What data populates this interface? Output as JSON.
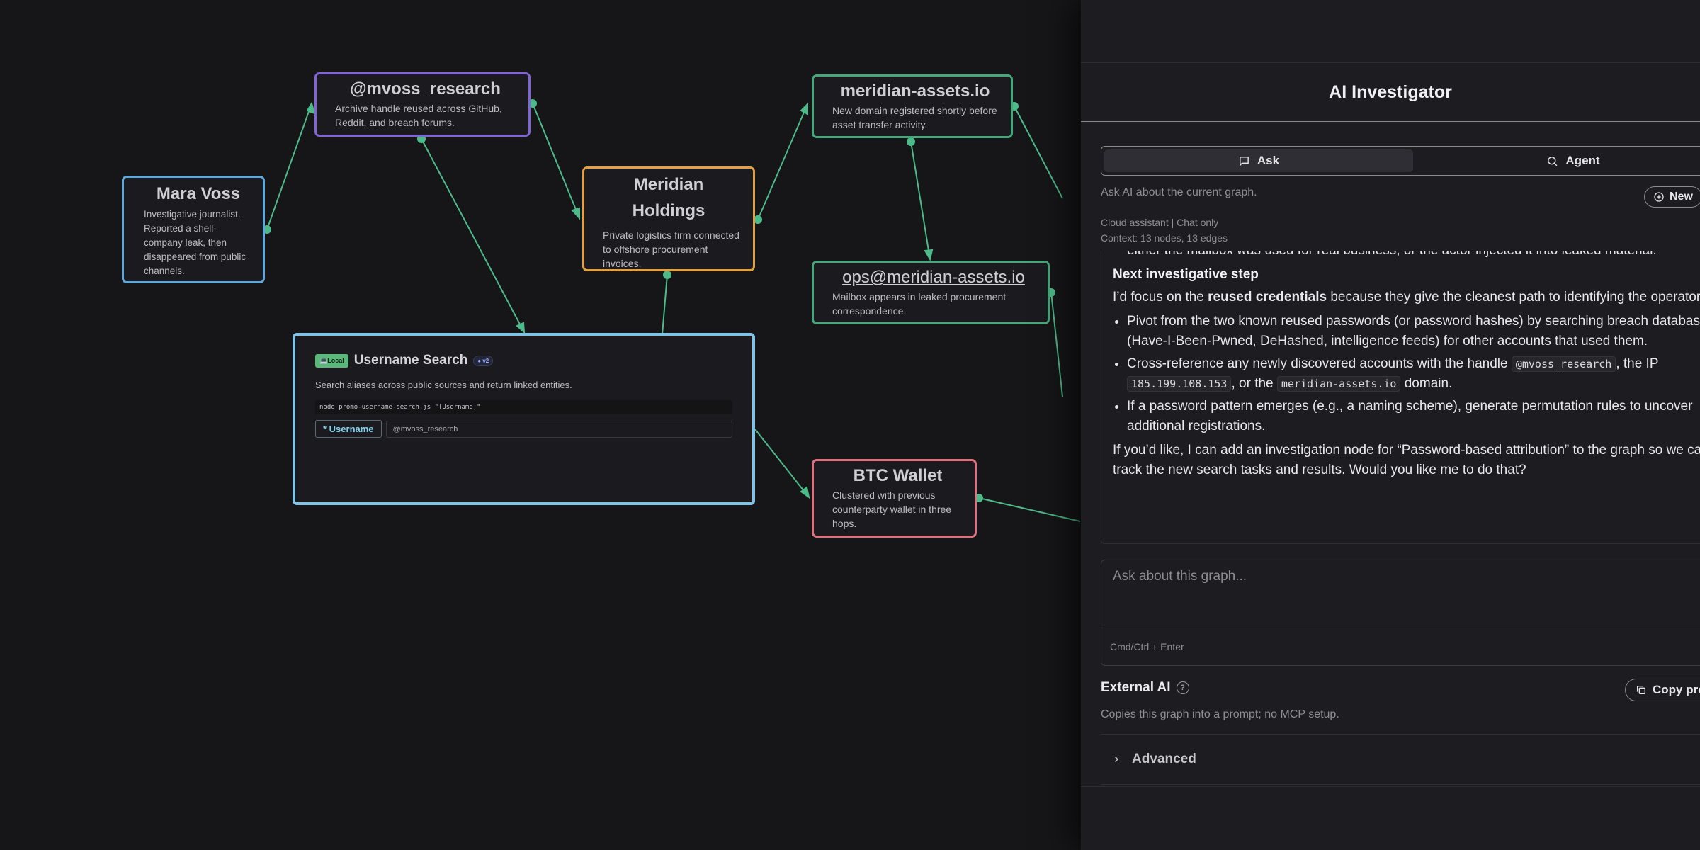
{
  "graph": {
    "nodes": {
      "mara": {
        "title": "Mara Voss",
        "desc": "Investigative journalist. Reported a shell-company leak, then disappeared from public channels."
      },
      "mvoss": {
        "title": "@mvoss_research",
        "desc": "Archive handle reused across GitHub, Reddit, and breach forums."
      },
      "meridian": {
        "title": "Meridian Holdings",
        "desc": "Private logistics firm connected to offshore procurement invoices."
      },
      "domain": {
        "title": "meridian-assets.io",
        "desc": "New domain registered shortly before asset transfer activity."
      },
      "ops": {
        "title": "ops@meridian-assets.io",
        "desc": "Mailbox appears in leaked procurement correspondence."
      },
      "btc": {
        "title": "BTC Wallet",
        "desc": "Clustered with previous counterparty wallet in three hops."
      }
    },
    "tool": {
      "badge_local": "Local",
      "title": "Username Search",
      "badge_version": "v2",
      "desc": "Search aliases across public sources and return linked entities.",
      "command": "node promo-username-search.js \"{Username}\"",
      "field_label": "* Username",
      "field_value": "@mvoss_research"
    },
    "edge_color": "#4dba8a"
  },
  "panel": {
    "title": "AI Investigator",
    "tabs": {
      "ask": "Ask",
      "agent": "Agent"
    },
    "ask_hint": "Ask AI about the current graph.",
    "new_chat": "New",
    "assistant_info": "Cloud assistant | Chat only",
    "context_info": "Context: 13 nodes, 13 edges",
    "chat": {
      "cut_line": "either the mailbox was used for real business, or the actor injected it into leaked material.",
      "heading": "Next investigative step",
      "intro_before": "I’d focus on the ",
      "intro_bold": "reused credentials",
      "intro_after": " because they give the cleanest path to identifying the operator:",
      "bullet1": "Pivot from the two known reused passwords (or password hashes) by searching breach databases (Have-I-Been-Pwned, DeHashed, intelligence feeds) for other accounts that used them.",
      "bullet2_a": "Cross-reference any newly discovered accounts with the handle ",
      "bullet2_code1": "@mvoss_research",
      "bullet2_b": ", the IP ",
      "bullet2_code2": "185.199.108.153",
      "bullet2_c": ", or the ",
      "bullet2_code3": "meridian-assets.io",
      "bullet2_d": " domain.",
      "bullet3": "If a password pattern emerges (e.g., a naming scheme), generate permutation rules to uncover additional registrations.",
      "closing": "If you’d like, I can add an investigation node for “Password-based attribution” to the graph so we can track the new search tasks and results. Would you like me to do that?"
    },
    "composer": {
      "placeholder": "Ask about this graph...",
      "hint": "Cmd/Ctrl + Enter"
    },
    "external": {
      "title": "External AI",
      "help": "?",
      "copy_button": "Copy pro",
      "desc": "Copies this graph into a prompt; no MCP setup."
    },
    "advanced": "Advanced"
  }
}
